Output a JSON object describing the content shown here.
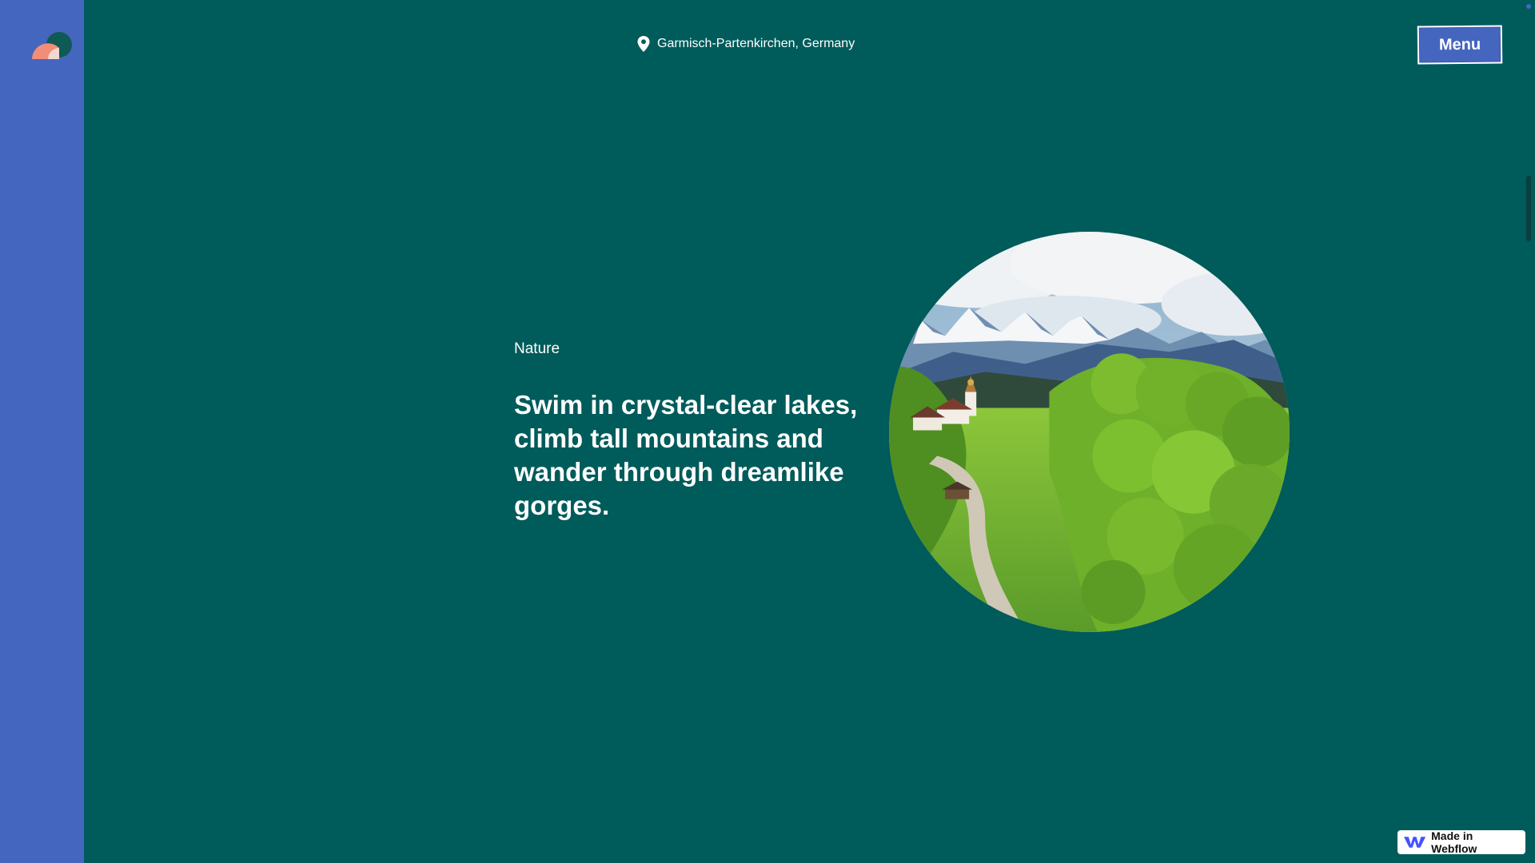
{
  "header": {
    "location": "Garmisch-Partenkirchen, Germany",
    "menu_label": "Menu"
  },
  "hero": {
    "eyebrow": "Nature",
    "headline": "Swim in crystal-clear lakes, climb tall mountains and wander through dreamlike gorges."
  },
  "badge": {
    "label": "Made in Webflow"
  },
  "icons": {
    "logo": "logo-icon",
    "location": "map-pin-icon",
    "webflow": "webflow-logo-icon"
  },
  "colors": {
    "background": "#005b5b",
    "sidebar": "#4566be",
    "menu_button": "#4566be",
    "text": "#ffffff"
  }
}
